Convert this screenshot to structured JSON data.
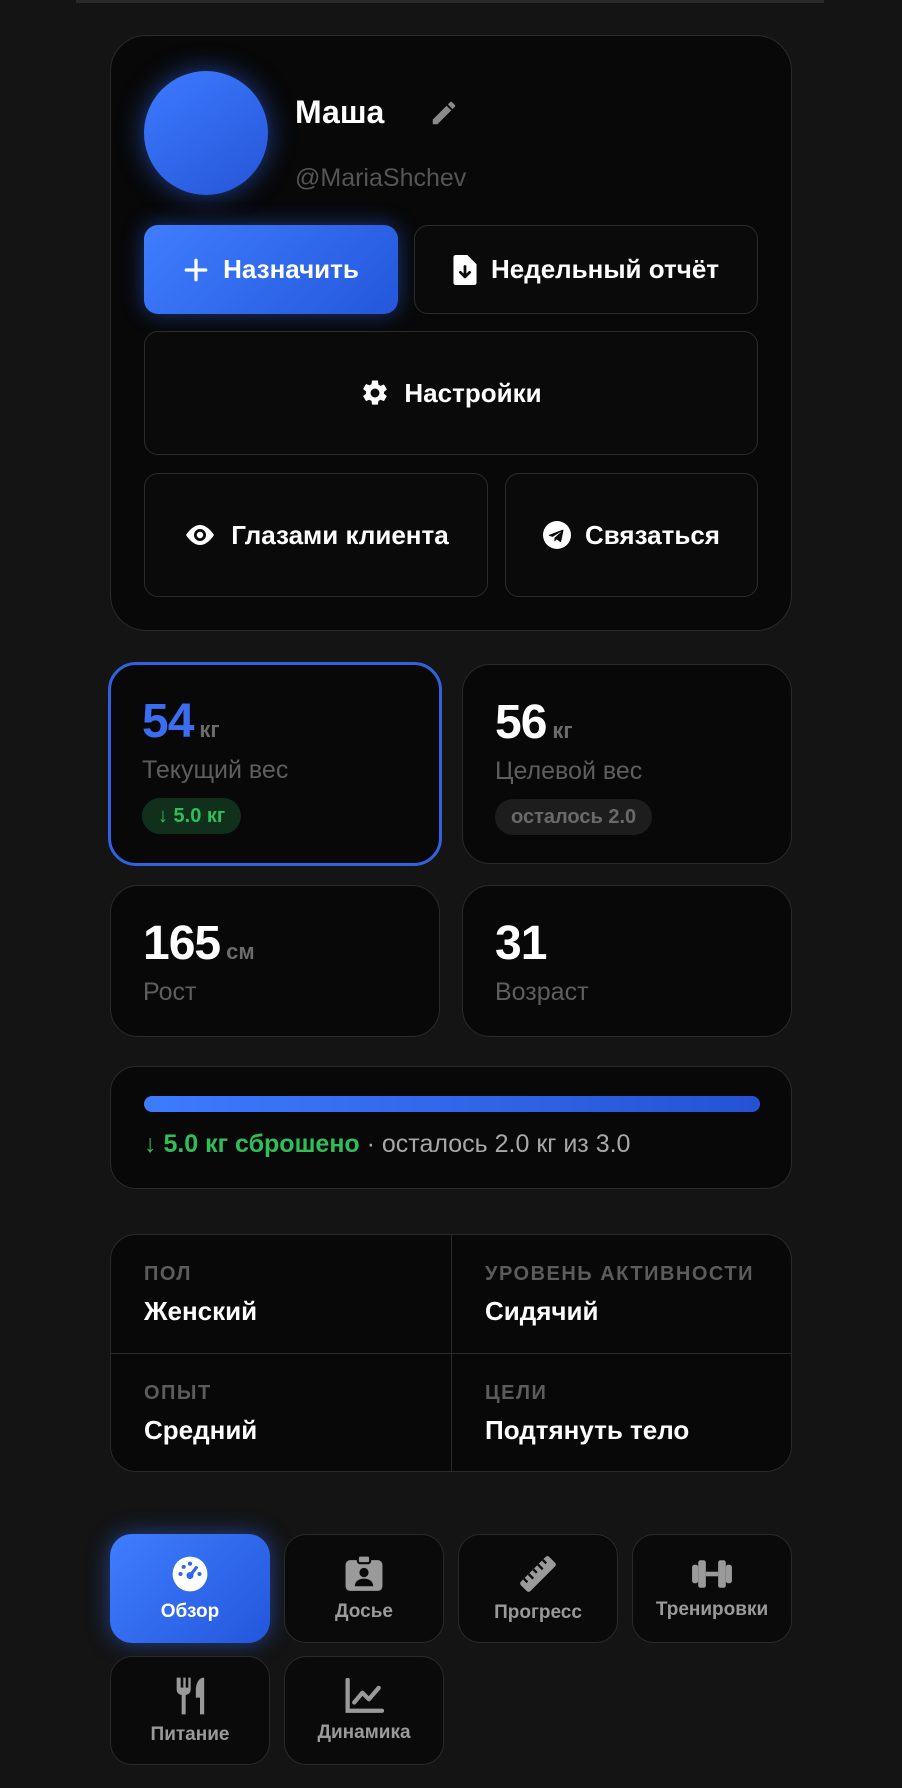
{
  "profile": {
    "name": "Маша",
    "handle": "@MariaShchev"
  },
  "actions": {
    "assign": "Назначить",
    "weekly_report": "Недельный отчёт",
    "settings": "Настройки",
    "client_view": "Глазами клиента",
    "contact": "Связаться"
  },
  "stats": {
    "current_weight": {
      "value": "54",
      "unit": "кг",
      "label": "Текущий вес",
      "badge": "↓ 5.0 кг"
    },
    "target_weight": {
      "value": "56",
      "unit": "кг",
      "label": "Целевой вес",
      "badge": "осталось 2.0"
    },
    "height": {
      "value": "165",
      "unit": "см",
      "label": "Рост"
    },
    "age": {
      "value": "31",
      "label": "Возраст"
    }
  },
  "progress": {
    "fill_fraction": 1.0,
    "lost_text": "↓ 5.0 кг сброшено",
    "rest_text": " · осталось 2.0 кг из 3.0"
  },
  "info": {
    "gender": {
      "key": "ПОЛ",
      "value": "Женский"
    },
    "activity": {
      "key": "УРОВЕНЬ АКТИВНОСТИ",
      "value": "Сидячий"
    },
    "experience": {
      "key": "ОПЫТ",
      "value": "Средний"
    },
    "goals": {
      "key": "ЦЕЛИ",
      "value": "Подтянуть тело"
    }
  },
  "tabs": [
    {
      "label": "Обзор",
      "icon": "dashboard-icon",
      "active": true
    },
    {
      "label": "Досье",
      "icon": "id-badge-icon",
      "active": false
    },
    {
      "label": "Прогресс",
      "icon": "ruler-icon",
      "active": false
    },
    {
      "label": "Тренировки",
      "icon": "dumbbell-icon",
      "active": false
    },
    {
      "label": "Питание",
      "icon": "utensils-icon",
      "active": false
    },
    {
      "label": "Динамика",
      "icon": "chart-line-icon",
      "active": false
    }
  ],
  "colors": {
    "accent": "#3d7bff",
    "success": "#2fbf5a",
    "background": "#141414",
    "card": "#080808"
  }
}
